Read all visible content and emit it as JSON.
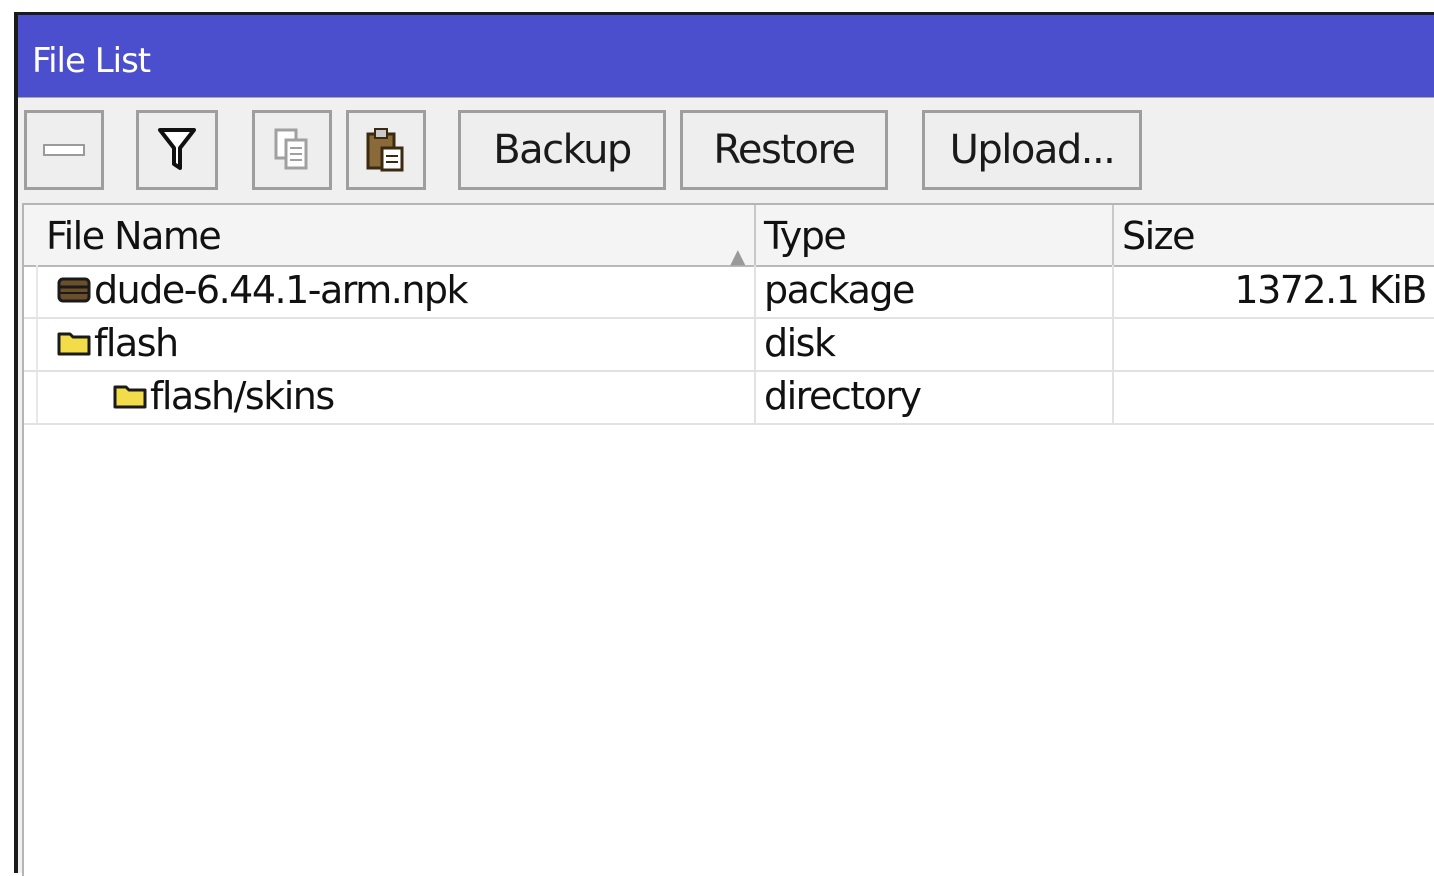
{
  "window": {
    "title": "File List"
  },
  "toolbar": {
    "remove_icon": "minus-icon",
    "filter_icon": "filter-icon",
    "copy_icon": "copy-icon",
    "paste_icon": "paste-icon",
    "backup_label": "Backup",
    "restore_label": "Restore",
    "upload_label": "Upload..."
  },
  "table": {
    "columns": [
      "File Name",
      "Type",
      "Size"
    ],
    "sort_indicator": "▲",
    "rows": [
      {
        "name": "dude-6.44.1-arm.npk",
        "type": "package",
        "size": "1372.1 KiB",
        "icon": "package-icon",
        "indent": 0
      },
      {
        "name": "flash",
        "type": "disk",
        "size": "",
        "icon": "folder-icon",
        "indent": 0
      },
      {
        "name": "flash/skins",
        "type": "directory",
        "size": "",
        "icon": "folder-icon",
        "indent": 1
      }
    ]
  },
  "colors": {
    "titlebar": "#4b4fcd",
    "folder": "#f2dc4a"
  }
}
